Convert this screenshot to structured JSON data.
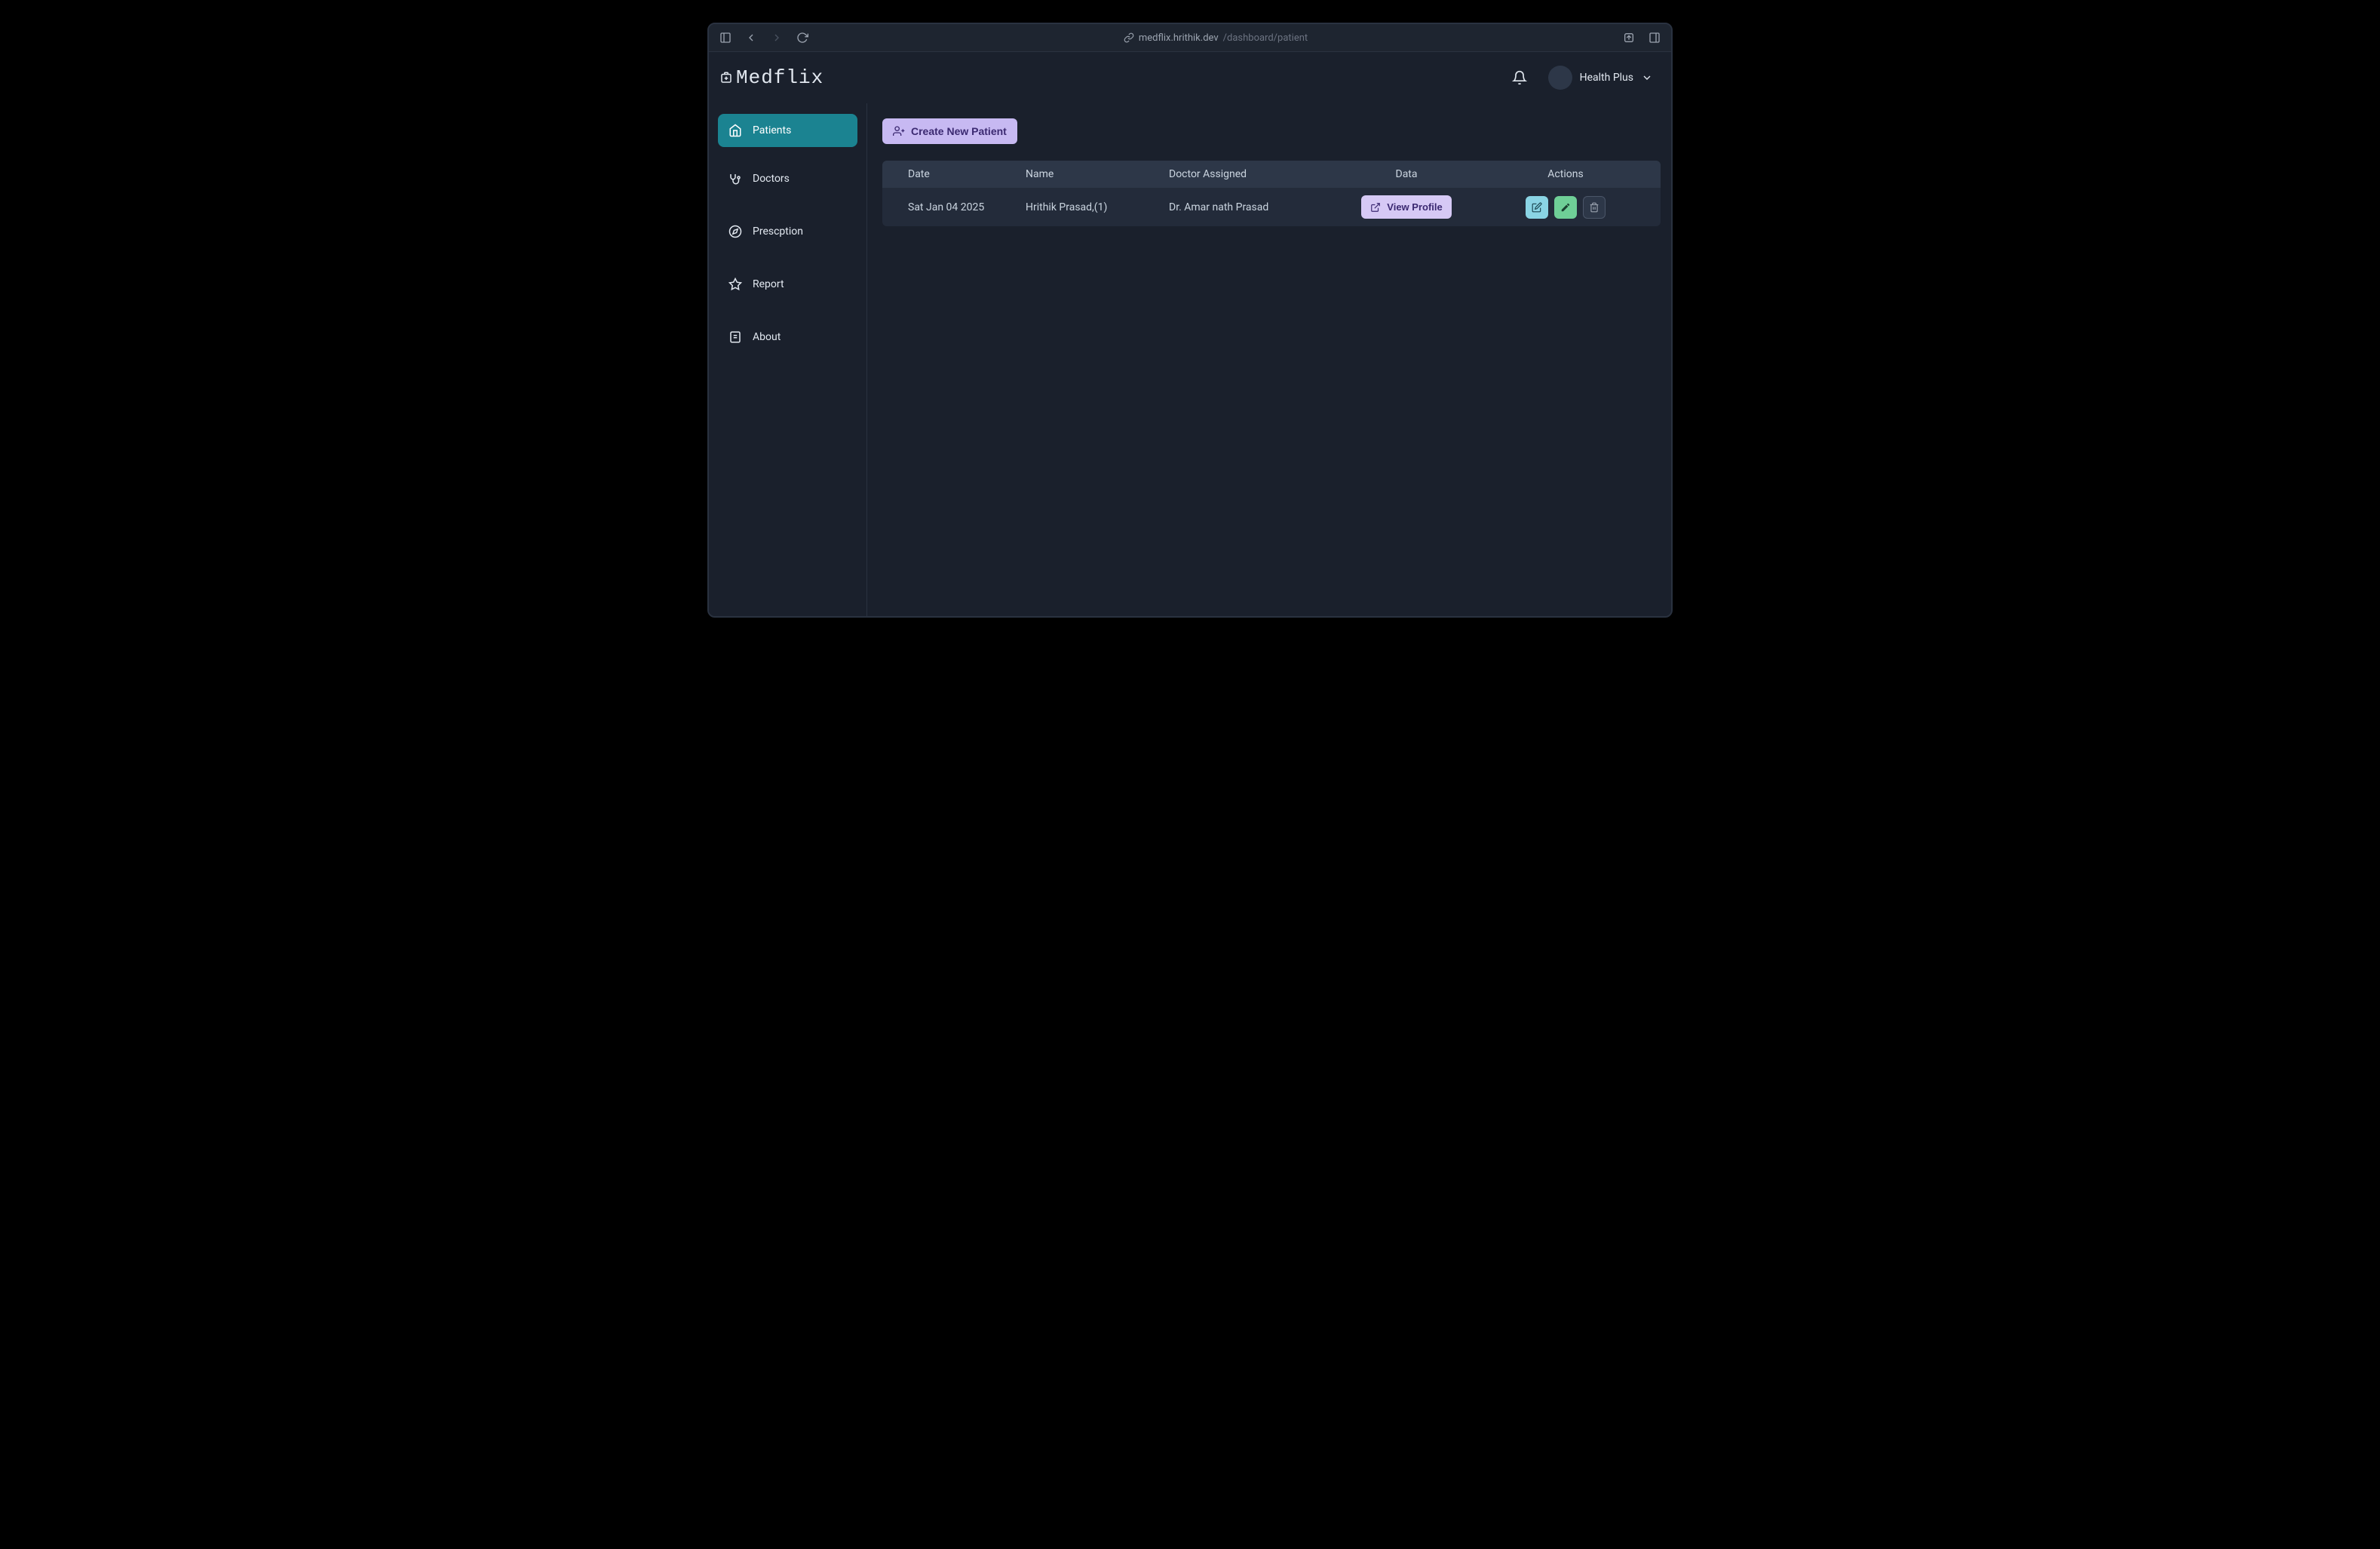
{
  "browser": {
    "url_host": "medflix.hrithik.dev",
    "url_path": "/dashboard/patient"
  },
  "app": {
    "name": "Medflix"
  },
  "header": {
    "user_name": "Health Plus"
  },
  "sidebar": {
    "items": [
      {
        "label": "Patients",
        "icon": "home",
        "active": true
      },
      {
        "label": "Doctors",
        "icon": "stethoscope",
        "active": false
      },
      {
        "label": "Prescption",
        "icon": "compass",
        "active": false
      },
      {
        "label": "Report",
        "icon": "star",
        "active": false
      },
      {
        "label": "About",
        "icon": "file",
        "active": false
      }
    ]
  },
  "main": {
    "create_button_label": "Create New Patient",
    "table": {
      "columns": {
        "date": "Date",
        "name": "Name",
        "doctor": "Doctor Assigned",
        "data": "Data",
        "actions": "Actions"
      },
      "rows": [
        {
          "date": "Sat Jan 04 2025",
          "name": "Hrithik Prasad,(1)",
          "doctor": "Dr. Amar nath Prasad",
          "view_label": "View Profile"
        }
      ]
    }
  }
}
